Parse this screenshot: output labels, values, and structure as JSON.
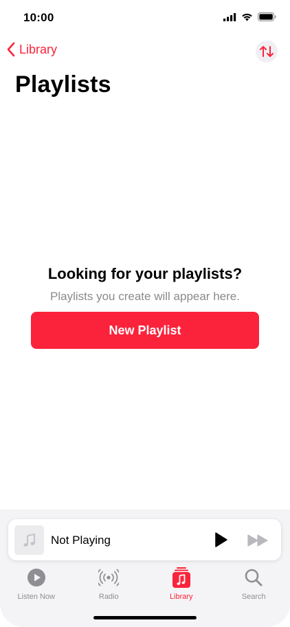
{
  "status_bar": {
    "time": "10:00"
  },
  "nav": {
    "back_label": "Library"
  },
  "page": {
    "title": "Playlists"
  },
  "empty_state": {
    "heading": "Looking for your playlists?",
    "subtitle": "Playlists you create will appear here.",
    "button_label": "New Playlist"
  },
  "mini_player": {
    "title": "Not Playing"
  },
  "tabs": [
    {
      "label": "Listen Now",
      "icon": "play-circle-icon",
      "active": false
    },
    {
      "label": "Radio",
      "icon": "radio-waves-icon",
      "active": false
    },
    {
      "label": "Library",
      "icon": "music-library-icon",
      "active": true
    },
    {
      "label": "Search",
      "icon": "magnifier-icon",
      "active": false
    }
  ],
  "colors": {
    "accent": "#fa233b",
    "inactive": "#8e8e93",
    "tab_background": "#f4f4f6"
  }
}
